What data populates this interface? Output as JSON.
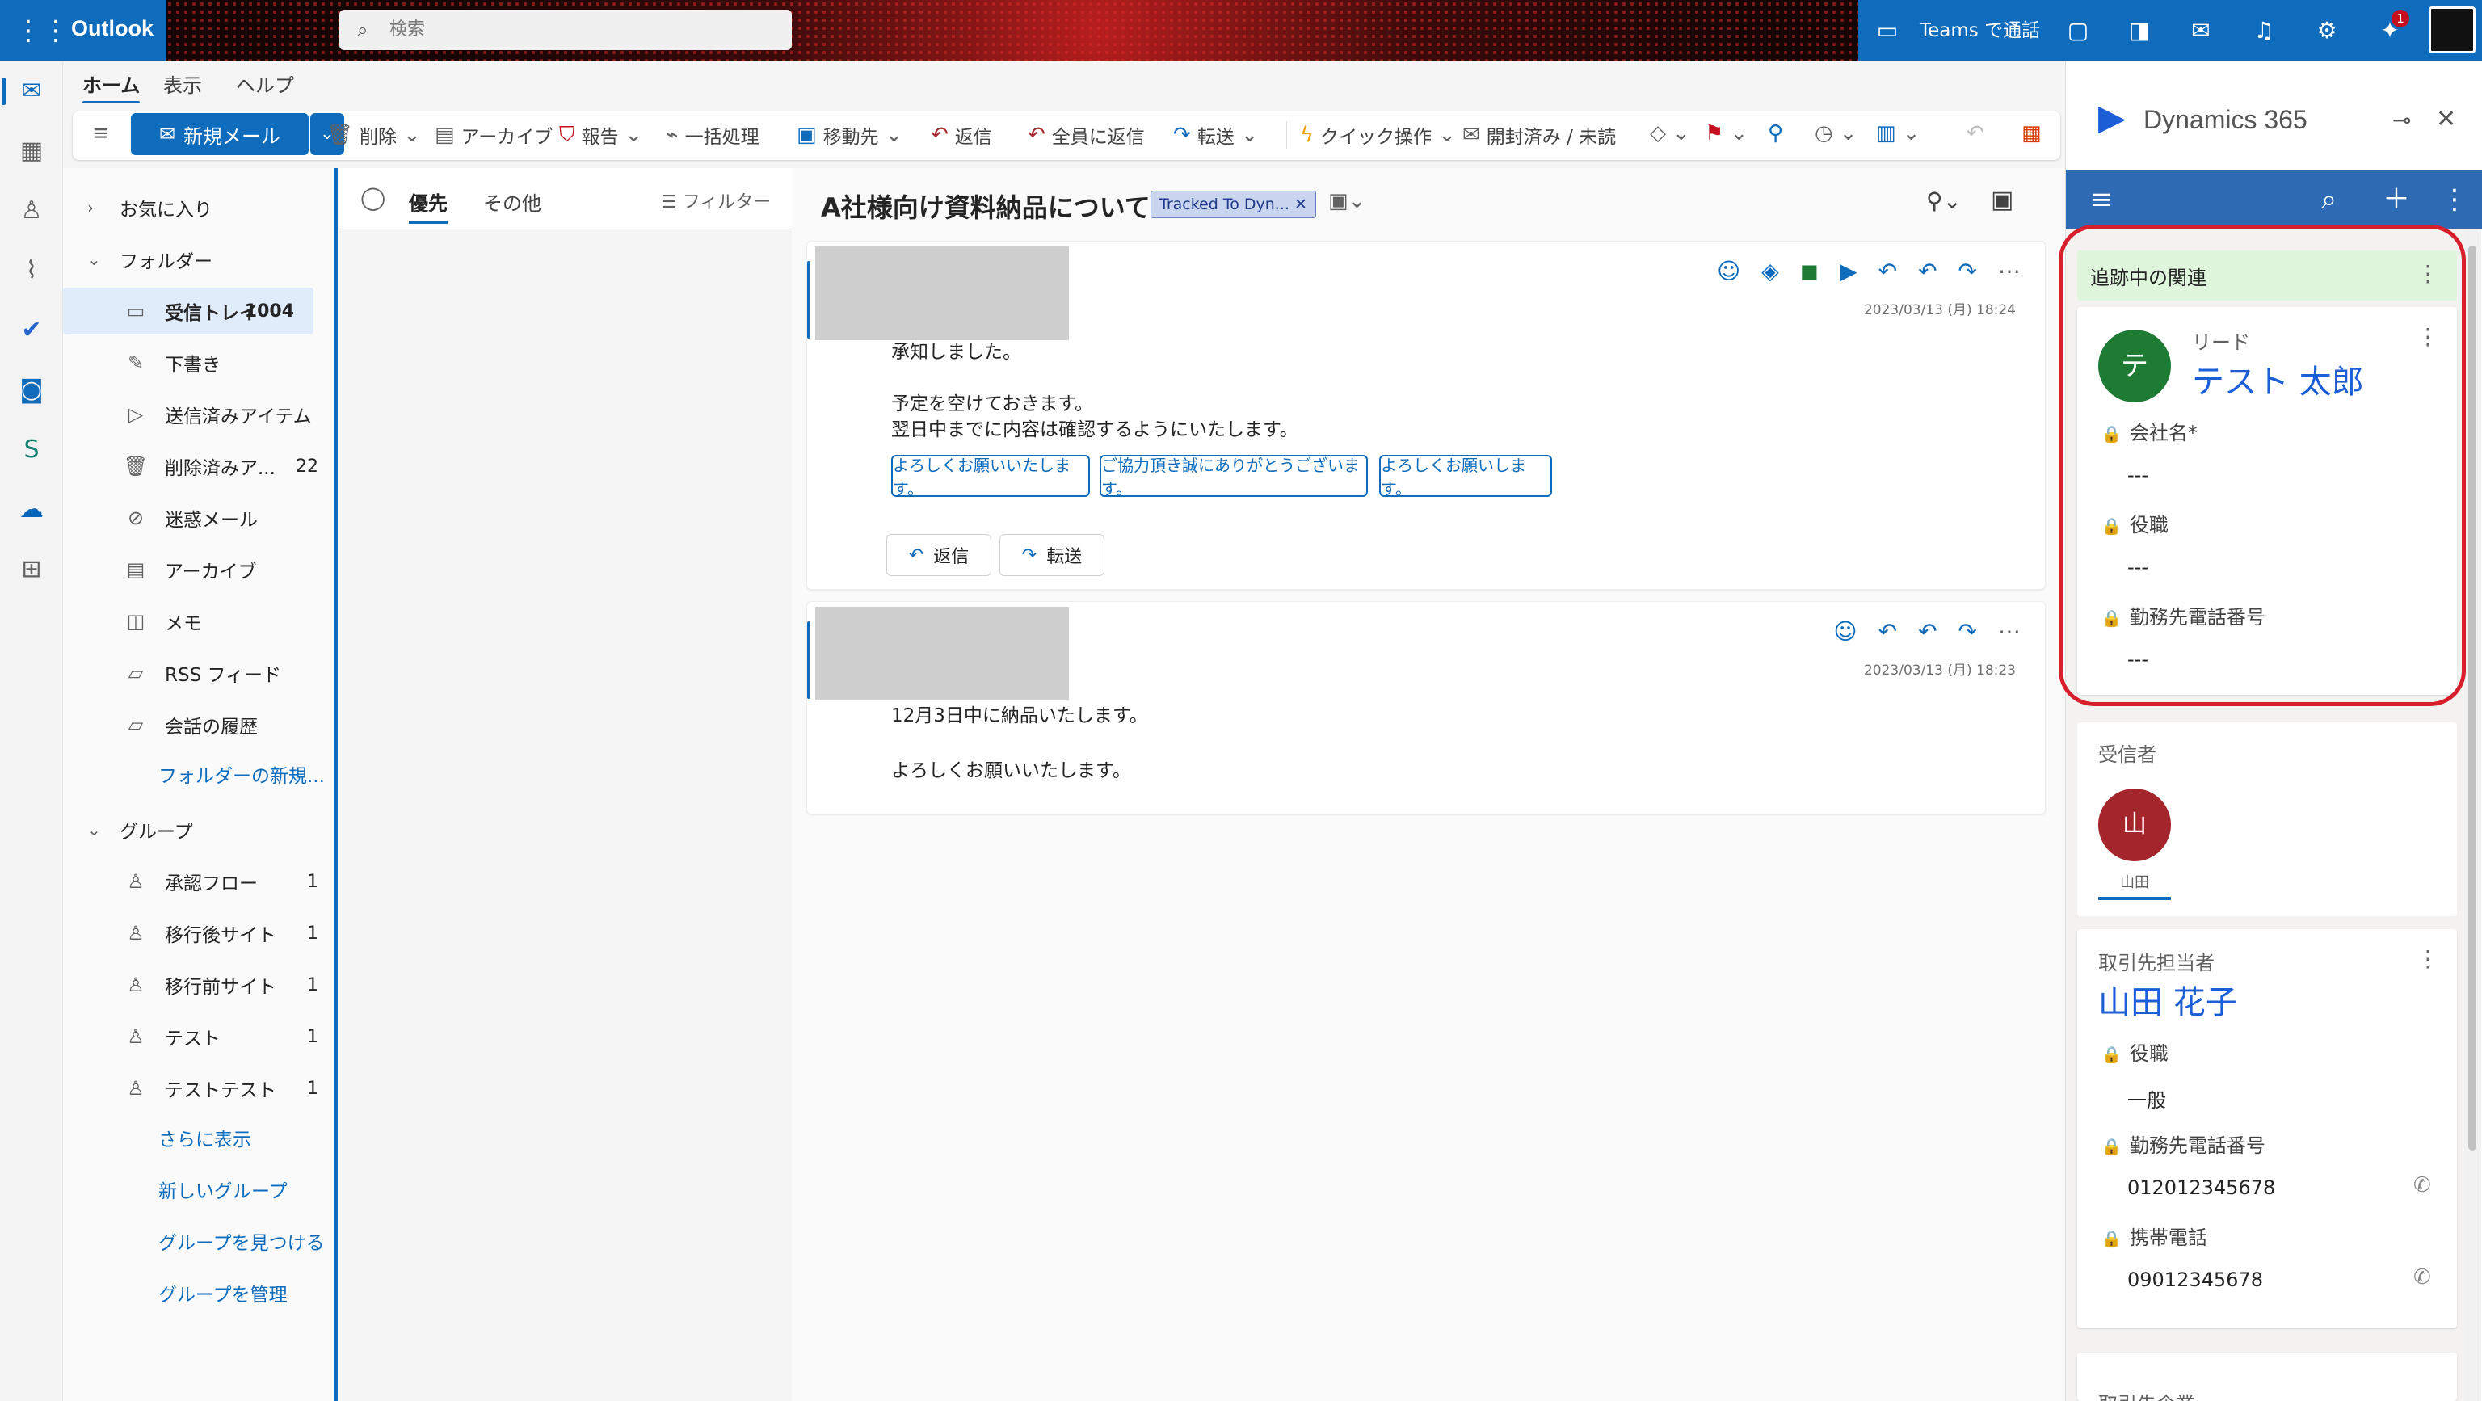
{
  "topbar": {
    "app_name": "Outlook",
    "search_placeholder": "検索",
    "teams_label": "Teams で通話",
    "notification_badge": "1"
  },
  "ribbon": {
    "tabs": [
      "ホーム",
      "表示",
      "ヘルプ"
    ],
    "new_mail": "新規メール",
    "delete": "削除",
    "archive": "アーカイブ",
    "report": "報告",
    "sweep": "一括処理",
    "move_to": "移動先",
    "reply": "返信",
    "reply_all": "全員に返信",
    "forward": "転送",
    "quick_steps": "クイック操作",
    "read_unread": "開封済み / 未読"
  },
  "folders": {
    "favorites": "お気に入り",
    "folders_header": "フォルダー",
    "items": [
      {
        "label": "受信トレイ",
        "count": "1004"
      },
      {
        "label": "下書き",
        "count": ""
      },
      {
        "label": "送信済みアイテム",
        "count": ""
      },
      {
        "label": "削除済みア...",
        "count": "22"
      },
      {
        "label": "迷惑メール",
        "count": ""
      },
      {
        "label": "アーカイブ",
        "count": ""
      },
      {
        "label": "メモ",
        "count": ""
      },
      {
        "label": "RSS フィード",
        "count": ""
      },
      {
        "label": "会話の履歴",
        "count": ""
      }
    ],
    "new_folder": "フォルダーの新規...",
    "groups_header": "グループ",
    "groups": [
      {
        "label": "承認フロー",
        "count": "1"
      },
      {
        "label": "移行後サイト",
        "count": "1"
      },
      {
        "label": "移行前サイト",
        "count": "1"
      },
      {
        "label": "テスト",
        "count": "1"
      },
      {
        "label": "テストテスト",
        "count": "1"
      }
    ],
    "show_more": "さらに表示",
    "new_group": "新しいグループ",
    "discover_groups": "グループを見つける",
    "manage_groups": "グループを管理"
  },
  "message_list": {
    "focused": "優先",
    "other": "その他",
    "filter": "フィルター"
  },
  "reading": {
    "subject": "A社様向け資料納品について",
    "tag": "Tracked To Dyn...",
    "messages": [
      {
        "date": "2023/03/13 (月) 18:24",
        "lines": [
          "承知しました。",
          "",
          "予定を空けておきます。",
          "翌日中までに内容は確認するようにいたします。"
        ],
        "suggestions": [
          "よろしくお願いいたします。",
          "ご協力頂き誠にありがとうございます。",
          "よろしくお願いします。"
        ],
        "reply": "返信",
        "forward": "転送"
      },
      {
        "date": "2023/03/13 (月) 18:23",
        "lines": [
          "12月3日中に納品いたします。",
          "",
          "よろしくお願いいたします。"
        ]
      }
    ]
  },
  "dynamics": {
    "title": "Dynamics 365",
    "tracked_header": "追跡中の関連",
    "lead": {
      "type": "リード",
      "initial": "テ",
      "name": "テスト 太郎",
      "fields": [
        {
          "label": "会社名*",
          "value": "---"
        },
        {
          "label": "役職",
          "value": "---"
        },
        {
          "label": "勤務先電話番号",
          "value": "---"
        }
      ]
    },
    "recipients_label": "受信者",
    "recipient": {
      "initial": "山",
      "name": "山田"
    },
    "contact": {
      "type": "取引先担当者",
      "name": "山田 花子",
      "fields": [
        {
          "label": "役職",
          "value": "一般"
        },
        {
          "label": "勤務先電話番号",
          "value": "012012345678"
        },
        {
          "label": "携帯電話",
          "value": "09012345678"
        }
      ]
    },
    "next_card_label": "取引先企業"
  },
  "colors": {
    "brand": "#0f6cbd",
    "dynamics_bar": "#2f6ab4",
    "highlight": "#d61f2a",
    "lead_avatar": "#1e7b34",
    "recipient_avatar": "#a4262c"
  }
}
